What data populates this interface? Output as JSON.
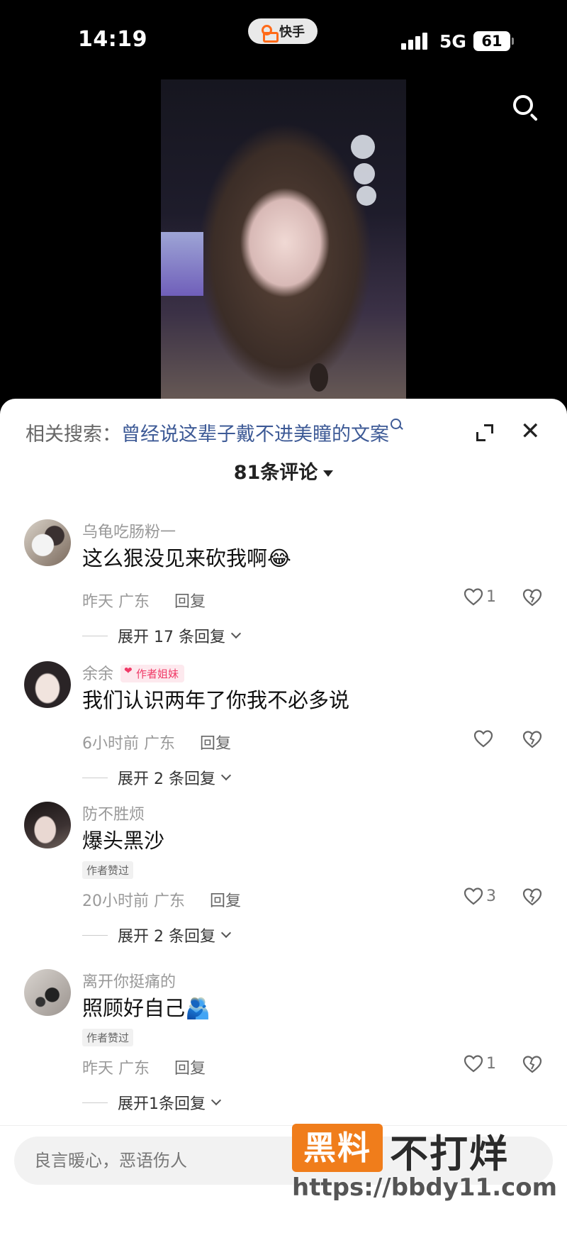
{
  "status_bar": {
    "time": "14:19",
    "app_name": "快手",
    "network": "5G",
    "battery": "61"
  },
  "related_search": {
    "prefix": "相关搜索：",
    "query": "曾经说这辈子戴不进美瞳的文案"
  },
  "comments_header": {
    "count_label": "81条评论"
  },
  "comments": [
    {
      "user": "乌龟吃肠粉一",
      "badge": "",
      "text": "这么狠没见来砍我啊😂",
      "liked_by_author": "",
      "time": "昨天",
      "location": "广东",
      "reply_label": "回复",
      "likes": "1",
      "expand_label": "展开 17 条回复"
    },
    {
      "user": "余余",
      "badge": "作者姐妹",
      "text": "我们认识两年了你我不必多说",
      "liked_by_author": "",
      "time": "6小时前",
      "location": "广东",
      "reply_label": "回复",
      "likes": "",
      "expand_label": "展开 2 条回复"
    },
    {
      "user": "防不胜烦",
      "badge": "",
      "text": "爆头黑沙",
      "liked_by_author": "作者赞过",
      "time": "20小时前",
      "location": "广东",
      "reply_label": "回复",
      "likes": "3",
      "expand_label": "展开 2 条回复"
    },
    {
      "user": "离开你挺痛的",
      "badge": "",
      "text": "照顾好自己🫂",
      "liked_by_author": "作者赞过",
      "time": "昨天",
      "location": "广东",
      "reply_label": "回复",
      "likes": "1",
      "expand_label": "展开1条回复"
    }
  ],
  "input": {
    "placeholder": "良言暖心，恶语伤人"
  },
  "watermark": {
    "box": "黑料",
    "big": "不打烊",
    "url": "https://bbdy11.com"
  },
  "colors": {
    "accent_orange": "#f07d1b",
    "link_blue": "#3d5a96",
    "badge_pink": "#f03a67"
  }
}
